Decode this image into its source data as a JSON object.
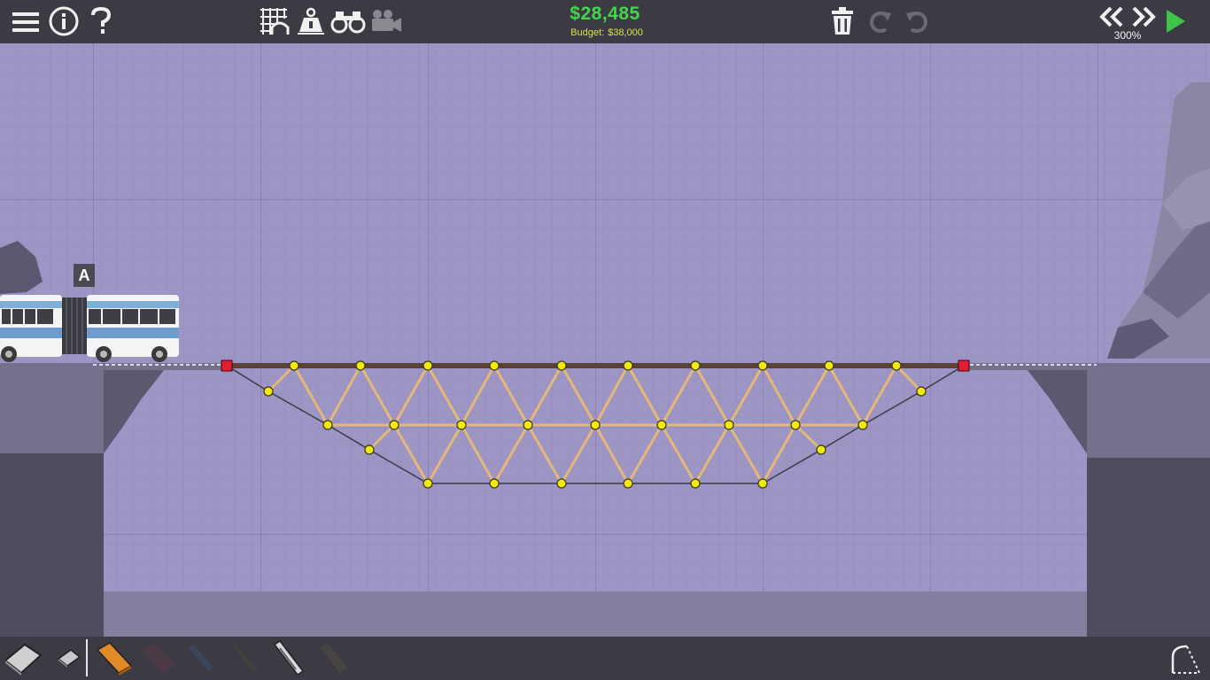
{
  "toolbar": {
    "menu_icon": "hamburger-icon",
    "info_icon": "info-icon",
    "help_icon": "question-icon",
    "grid_icon": "grid-arch-icon",
    "weight_icon": "weight-icon",
    "binoculars_icon": "binoculars-icon",
    "camera_icon": "camera-icon",
    "delete_icon": "trash-icon",
    "redo_icon": "redo-icon",
    "undo_icon": "undo-icon",
    "rewind_icon": "rewind-icon",
    "fastforward_icon": "fast-forward-icon",
    "play_icon": "play-icon"
  },
  "cost": "$28,485",
  "budget": {
    "label": "Budget:",
    "value": "$38,000"
  },
  "sim_speed": "300%",
  "vehicle_label": "A",
  "materials": [
    {
      "name": "big-eraser",
      "active": true
    },
    {
      "name": "small-eraser",
      "active": true
    },
    {
      "name": "road",
      "active": true
    },
    {
      "name": "reinforced-road",
      "active": false
    },
    {
      "name": "wood",
      "active": false
    },
    {
      "name": "steel",
      "active": false
    },
    {
      "name": "hydraulics",
      "active": true
    },
    {
      "name": "rope",
      "active": false
    }
  ],
  "colors": {
    "background": "#9d95c4",
    "toolbar": "#3c3b44",
    "cost_green": "#41d64c",
    "budget_yellow": "#d9e24c",
    "road": "#5a4236",
    "wood": "#e3b97a",
    "rope": "#3a3a45",
    "joint": "#f2e90d",
    "anchor": "#e01e35",
    "play_green": "#3ec54a"
  }
}
